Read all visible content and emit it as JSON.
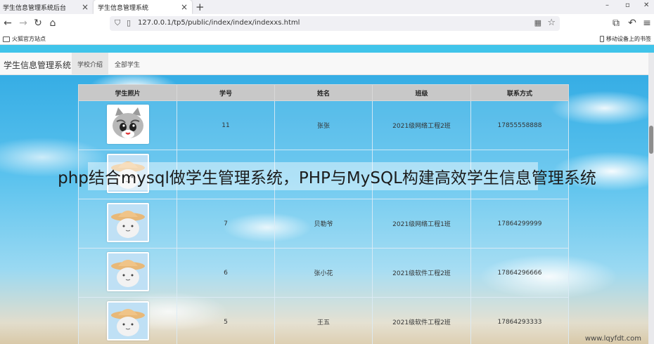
{
  "browser": {
    "tabs": [
      {
        "label": "学生信息管理系统后台",
        "close": "×"
      },
      {
        "label": "学生信息管理系统",
        "close": "×"
      }
    ],
    "new_tab": "+",
    "window_controls": {
      "minimize": "–",
      "maximize": "▫",
      "close": "✕"
    },
    "url": "127.0.0.1/tp5/public/index/index/indexxs.html",
    "bookmarks": {
      "left": "火狐官方站点",
      "right": "移动设备上的书签"
    }
  },
  "app": {
    "brand": "学生信息管理系统",
    "nav": [
      {
        "label": "学校介绍"
      },
      {
        "label": "全部学生"
      }
    ]
  },
  "table": {
    "headers": [
      "学生照片",
      "学号",
      "姓名",
      "班级",
      "联系方式"
    ],
    "rows": [
      {
        "photo": "cat-avatar",
        "id": "11",
        "name": "张张",
        "class": "2021级网络工程2班",
        "phone": "17855558888"
      },
      {
        "photo": "hat-avatar",
        "id": "",
        "name": "",
        "class": "",
        "phone": ""
      },
      {
        "photo": "hat-avatar",
        "id": "7",
        "name": "贝勒爷",
        "class": "2021级网络工程1班",
        "phone": "17864299999"
      },
      {
        "photo": "hat-avatar",
        "id": "6",
        "name": "张小花",
        "class": "2021级软件工程2班",
        "phone": "17864296666"
      },
      {
        "photo": "hat-avatar",
        "id": "5",
        "name": "王五",
        "class": "2021级软件工程2班",
        "phone": "17864293333"
      }
    ]
  },
  "overlay_caption": "php结合mysql做学生管理系统，PHP与MySQL构建高效学生信息管理系统",
  "watermark": "www.lqyfdt.com"
}
